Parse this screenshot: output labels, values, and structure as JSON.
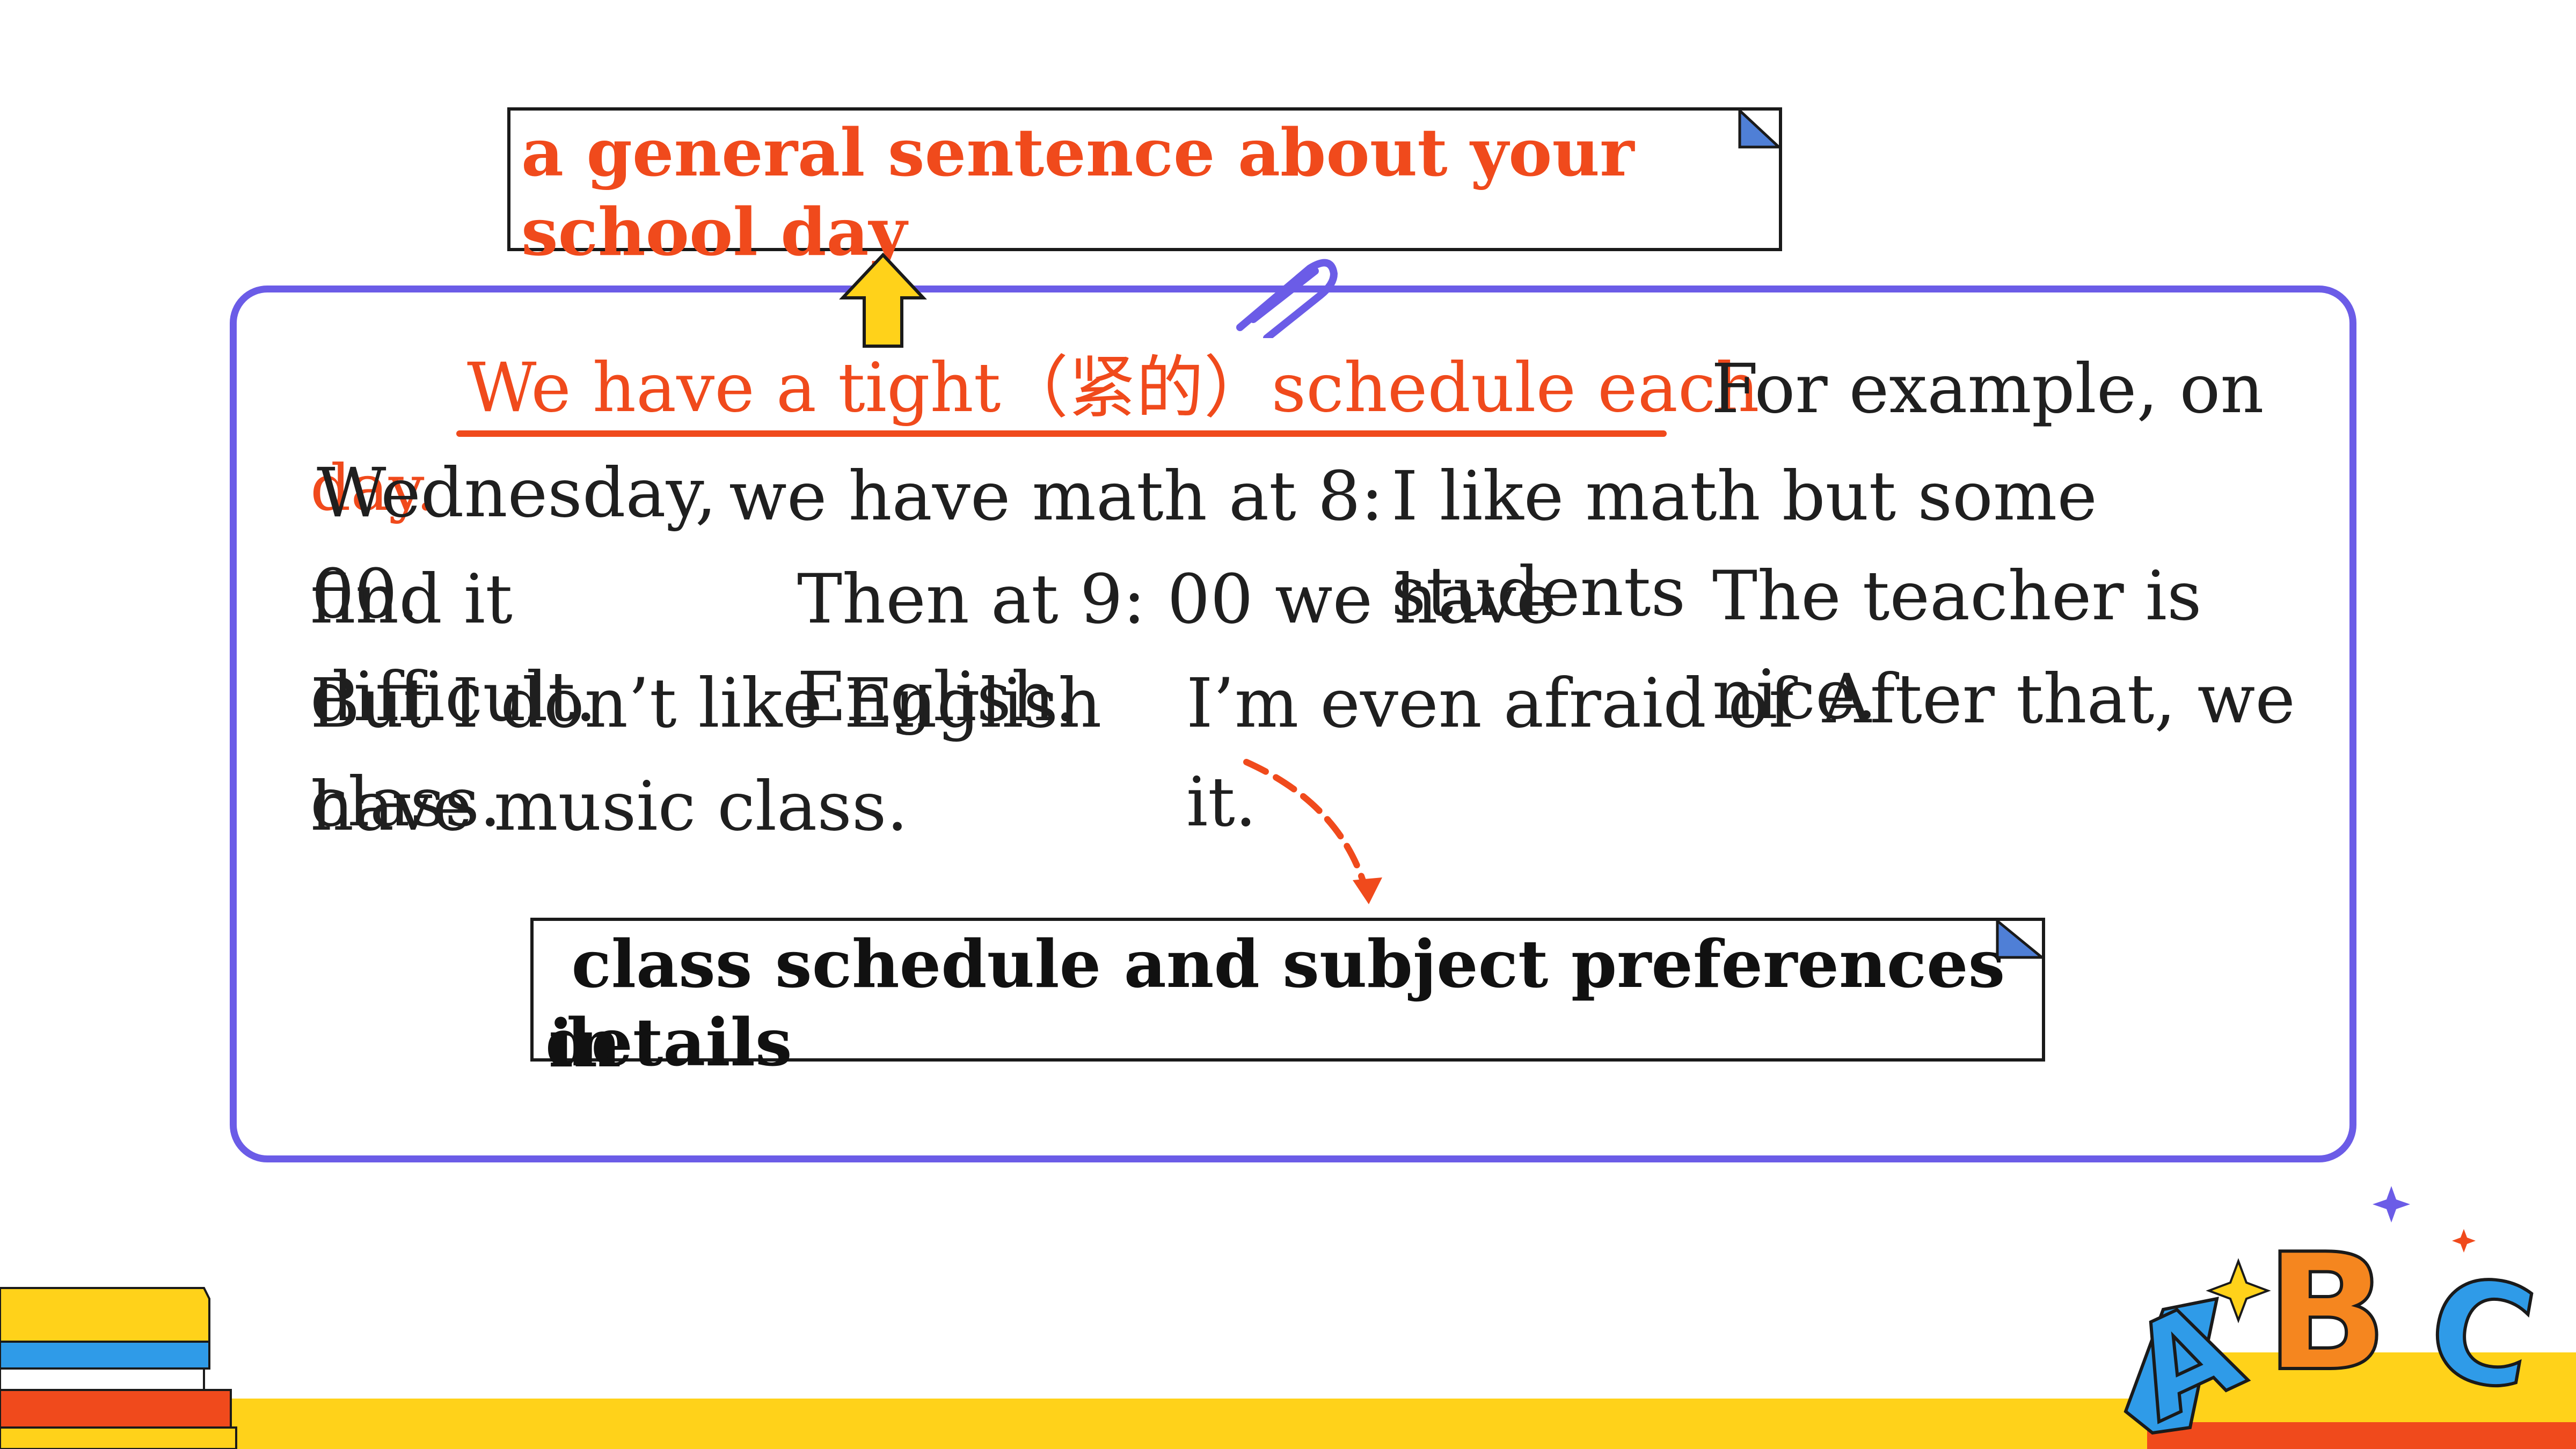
{
  "top_label": {
    "text_line1": "a general sentence about your",
    "text_line2": "school day"
  },
  "bottom_label": {
    "text_line1": " class schedule and subject preferences  in",
    "text_line2": "details"
  },
  "passage": {
    "topic_sentence": "We have a tight（紧的）schedule each",
    "topic_day": "day.",
    "segments": [
      "For example, on",
      "Wednesday,",
      "we have math at 8:",
      "00.",
      "I like math but some",
      "students",
      "find it",
      "difficult.",
      "Then at 9: 00 we have",
      "English.",
      "The teacher is",
      "nice.",
      "But I don’t like English",
      "class.",
      "I’m even afraid of",
      "it.",
      "After that, we",
      "have music class."
    ]
  },
  "decor": {
    "letters": [
      "A",
      "B",
      "C"
    ],
    "colors": {
      "accent_red": "#f04a1c",
      "panel_border": "#6b5ce7",
      "yellow": "#ffd21a",
      "blue": "#2f9be8",
      "orange": "#f5861f"
    }
  }
}
